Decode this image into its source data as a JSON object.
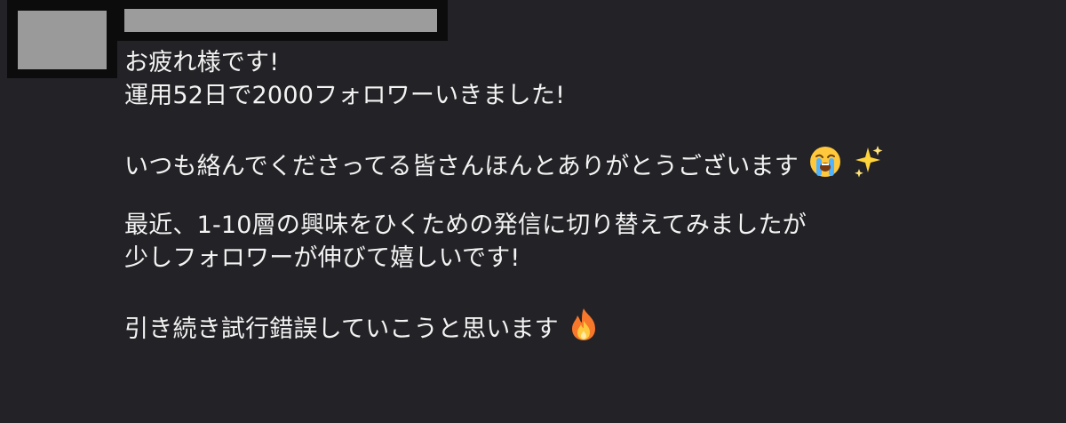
{
  "comment": {
    "lines": [
      "お疲れ様です!",
      "運用52日で2000フォロワーいきました!",
      "いつも絡んでくださってる皆さんほんとありがとうございます",
      "最近、1-10層の興味をひくための発信に切り替えてみましたが",
      "少しフォロワーが伸びて嬉しいです!",
      "引き続き試行錯誤していこうと思います"
    ],
    "emoji": {
      "crying_face": "crying-face-icon",
      "sparkles": "sparkles-icon",
      "fire": "fire-icon"
    }
  },
  "colors": {
    "background": "#232226",
    "text": "#f3f3f3",
    "redaction_frame": "#0c0c0d",
    "redaction_fill": "#9c9c9c"
  }
}
